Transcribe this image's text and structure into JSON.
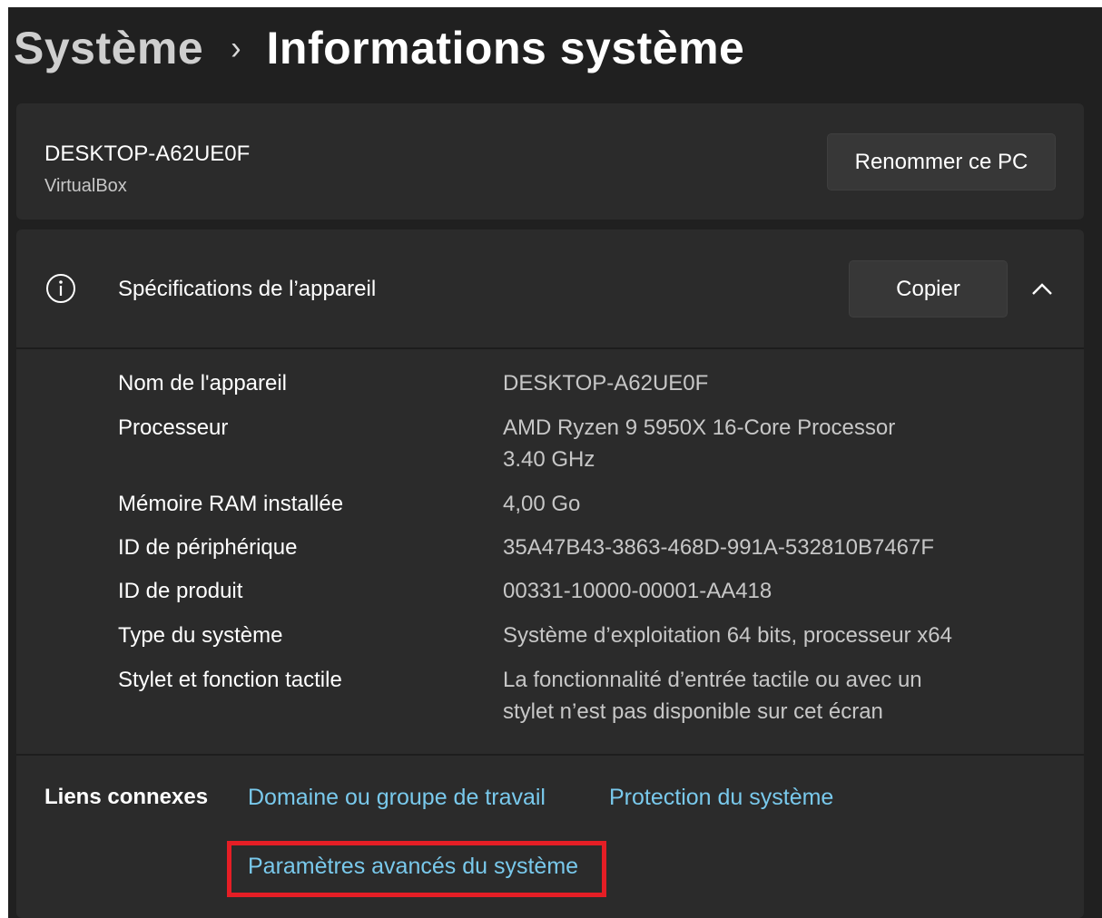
{
  "breadcrumb": {
    "parent": "Système",
    "separator": "›",
    "current": "Informations système"
  },
  "pc": {
    "name": "DESKTOP-A62UE0F",
    "model": "VirtualBox",
    "rename_label": "Renommer ce PC"
  },
  "specs": {
    "icon": "info-icon",
    "title": "Spécifications de l’appareil",
    "copy_label": "Copier",
    "expand_icon": "chevron-up-icon",
    "rows": [
      {
        "label": "Nom de l'appareil",
        "value": "DESKTOP-A62UE0F"
      },
      {
        "label": "Processeur",
        "value_lines": [
          "AMD Ryzen 9 5950X 16-Core Processor",
          "3.40 GHz"
        ]
      },
      {
        "label": "Mémoire RAM installée",
        "value": "4,00 Go"
      },
      {
        "label": "ID de périphérique",
        "value": "35A47B43-3863-468D-991A-532810B7467F"
      },
      {
        "label": "ID de produit",
        "value": "00331-10000-00001-AA418"
      },
      {
        "label": "Type du système",
        "value": "Système d’exploitation 64 bits, processeur x64"
      },
      {
        "label": "Stylet et fonction tactile",
        "value_lines": [
          "La fonctionnalité d’entrée tactile ou avec un",
          "stylet n’est pas disponible sur cet écran"
        ]
      }
    ]
  },
  "related_links": {
    "label": "Liens connexes",
    "links": [
      "Domaine ou groupe de travail",
      "Protection du système",
      "Paramètres avancés du système"
    ]
  },
  "colors": {
    "background": "#202020",
    "card": "#2b2b2b",
    "link": "#79c9ec",
    "highlight": "#e51e25"
  }
}
